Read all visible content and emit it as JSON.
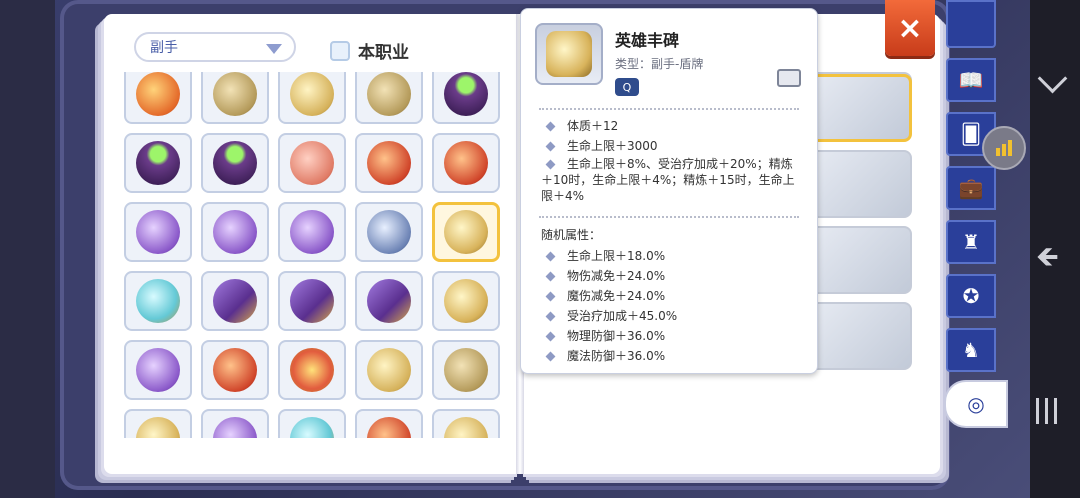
{
  "filter": {
    "category": "副手",
    "class_only_label": "本职业"
  },
  "grid": {
    "rows": [
      [
        "ic-orange",
        "ic-bronze",
        "ic-gold",
        "ic-bronze",
        "ic-purple-pot"
      ],
      [
        "ic-purple-pot",
        "ic-purple-pot",
        "ic-pink",
        "ic-red",
        "ic-red"
      ],
      [
        "ic-purple",
        "ic-purple",
        "ic-purple",
        "ic-shield",
        "ic-shield-gold"
      ],
      [
        "ic-teal",
        "ic-book",
        "ic-book",
        "ic-book",
        "ic-shield-gold"
      ],
      [
        "ic-purple",
        "ic-red",
        "ic-star",
        "ic-gold",
        "ic-bronze"
      ],
      [
        "ic-shield-gold",
        "ic-purple",
        "ic-teal",
        "ic-red",
        "ic-gold"
      ]
    ],
    "selected": [
      2,
      4
    ]
  },
  "tooltip": {
    "name": "英雄丰碑",
    "type": "类型：副手-盾牌",
    "type_icon": "Q",
    "base_stats": [
      "体质＋12",
      "生命上限＋3000"
    ],
    "refine_stat": "生命上限＋8%、受治疗加成＋20%；精炼＋10时，生命上限＋4%；精炼＋15时，生命上限＋4%",
    "random_title": "随机属性：",
    "random_stats": [
      "生命上限＋18.0%",
      "物伤减免＋24.0%",
      "魔伤减免＋24.0%",
      "受治疗加成＋45.0%",
      "物理防御＋36.0%",
      "魔法防御＋36.0%"
    ]
  },
  "close_label": "×",
  "side_tabs": [
    "book-icon",
    "card-icon",
    "briefcase-icon",
    "throne-icon",
    "medal-icon",
    "rocking-horse-icon",
    "emblem-icon"
  ]
}
